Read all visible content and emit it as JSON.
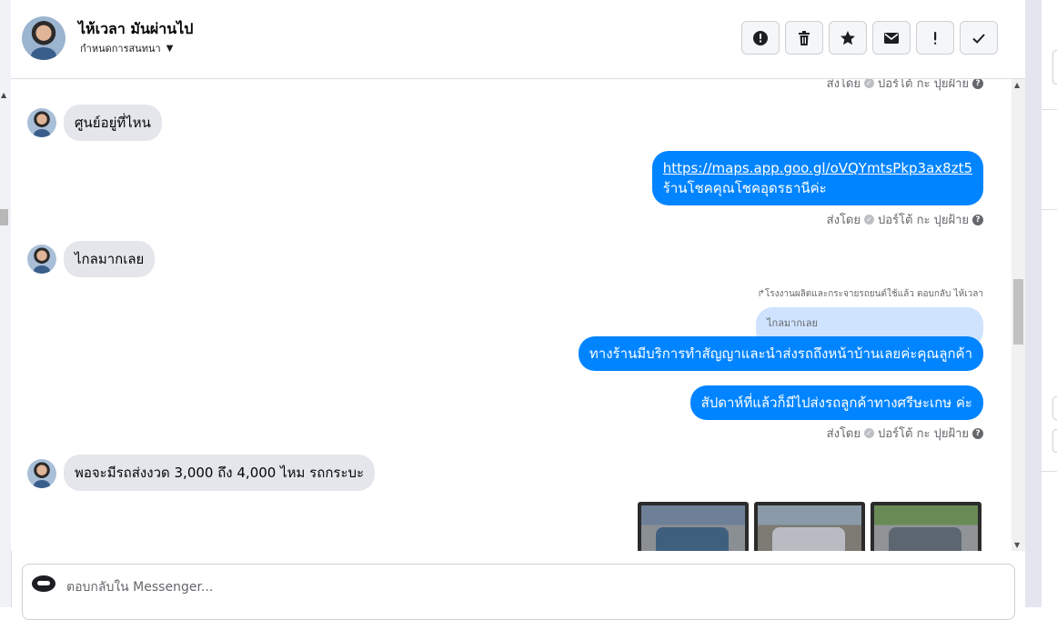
{
  "conversation": {
    "contact_name": "ไห้เวลา มันผ่านไป",
    "assign_label": "กำหนดการสนทนา"
  },
  "toolbar": {
    "buttons": [
      {
        "icon": "alert-circle-icon",
        "label": "!"
      },
      {
        "icon": "trash-icon"
      },
      {
        "icon": "star-icon"
      },
      {
        "icon": "envelope-icon"
      },
      {
        "icon": "exclamation-icon",
        "label": "!"
      },
      {
        "icon": "check-icon"
      }
    ]
  },
  "messages": {
    "top_meta": {
      "prefix": "ส่งโดย",
      "agent": "ปอร์โต้ กะ ปุยฝ้าย"
    },
    "m1": {
      "text": "ศูนย์อยู่ที่ไหน"
    },
    "m2": {
      "link": "https://maps.app.goo.gl/oVQYmtsPkp3ax8zt5",
      "text": "ร้านโชคคุณโชคอุดรธานีค่ะ"
    },
    "meta2": {
      "prefix": "ส่งโดย",
      "agent": "ปอร์โต้ กะ ปุยฝ้าย"
    },
    "m3": {
      "text": "ไกลมากเลย"
    },
    "reply_note": "↱โรงงานผลิตและกระจายรถยนต์ใช้แล้ว ตอบกลับ ไห้เวลา",
    "quoted": "ไกลมากเลย",
    "m4": {
      "text": "ทางร้านมีบริการทำสัญญาและนำส่งรถถึงหน้าบ้านเลยค่ะคุณลูกค้า"
    },
    "m5": {
      "text": "สัปดาห์ที่แล้วก็มีไปส่งรถลูกค้าทางศรีษะเกษ ค่ะ"
    },
    "meta3": {
      "prefix": "ส่งโดย",
      "agent": "ปอร์โต้ กะ ปุยฝ้าย"
    },
    "m6": {
      "text": "พอจะมีรถส่งงวด 3,000 ถึง 4,000 ไหม รถกระบะ"
    }
  },
  "photos": [
    {
      "name": "pickup-truck-blue",
      "color": "#3f5f7f"
    },
    {
      "name": "pickup-truck-silver",
      "color": "#b8bcc2"
    },
    {
      "name": "pickup-truck-gray",
      "color": "#5c6670"
    }
  ],
  "composer": {
    "placeholder": "ตอบกลับใน Messenger..."
  },
  "colors": {
    "outgoing_bubble": "#0084ff",
    "incoming_bubble": "#e4e6eb",
    "quoted_bubble": "#cfe3ff"
  }
}
